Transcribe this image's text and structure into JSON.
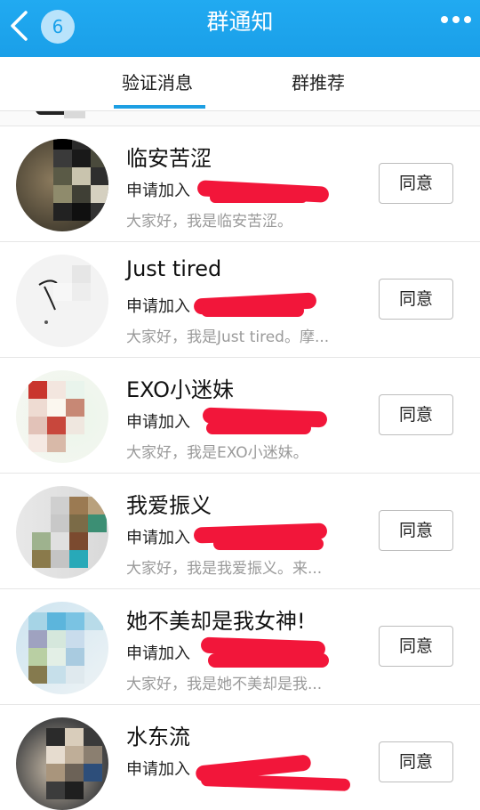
{
  "header": {
    "title": "群通知",
    "back_badge": "6"
  },
  "tabs": [
    {
      "label": "验证消息",
      "active": true
    },
    {
      "label": "群推荐",
      "active": false
    }
  ],
  "requests": [
    {
      "name": "临安苦涩",
      "request": "申请加入",
      "message": "大家好，我是临安苦涩。",
      "button": "同意"
    },
    {
      "name": "Just  tired",
      "request": "申请加入",
      "message": "大家好，我是Just tired。摩...",
      "button": "同意"
    },
    {
      "name": "EXO小迷妹",
      "request": "申请加入",
      "message": "大家好，我是EXO小迷妹。",
      "button": "同意"
    },
    {
      "name": "我爱振义",
      "request": "申请加入",
      "message": "大家好，我是我爱振义。来...",
      "button": "同意"
    },
    {
      "name": "她不美却是我女神!",
      "request": "申请加入",
      "message": "大家好，我是她不美却是我...",
      "button": "同意"
    },
    {
      "name": "水东流",
      "request": "申请加入",
      "message": "",
      "button": "同意"
    }
  ],
  "colors": {
    "header": "#1a9fe8",
    "tab_indicator": "#1d9fe3",
    "redaction": "#f2163a"
  }
}
